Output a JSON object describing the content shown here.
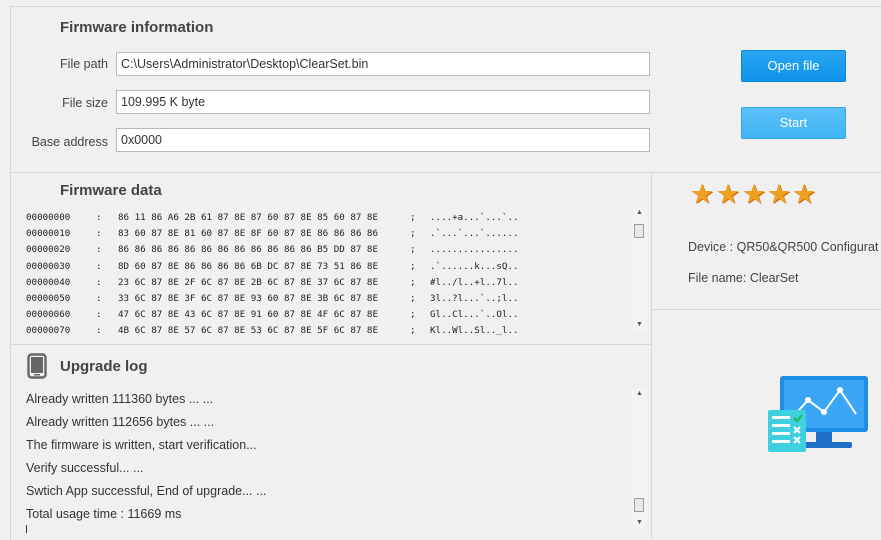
{
  "firmware_info": {
    "title": "Firmware information",
    "file_path_label": "File path",
    "file_path_value": "C:\\Users\\Administrator\\Desktop\\ClearSet.bin",
    "file_size_label": "File size",
    "file_size_value": "109.995 K byte",
    "base_address_label": "Base address",
    "base_address_value": "0x0000"
  },
  "buttons": {
    "open_file": "Open file",
    "start": "Start"
  },
  "firmware_data": {
    "title": "Firmware data",
    "rows": [
      {
        "offset": "00000000",
        "colon": ":",
        "bytes": "86 11 86 A6 2B 61 87 8E 87 60 87 8E 85 60 87 8E",
        "sep": ";",
        "ascii": "....+a...`...`.."
      },
      {
        "offset": "00000010",
        "colon": ":",
        "bytes": "83 60 87 8E 81 60 87 8E 8F 60 87 8E 86 86 86 86",
        "sep": ";",
        "ascii": ".`...`...`......"
      },
      {
        "offset": "00000020",
        "colon": ":",
        "bytes": "86 86 86 86 86 86 86 86 86 86 86 86 B5 DD 87 8E",
        "sep": ";",
        "ascii": "................"
      },
      {
        "offset": "00000030",
        "colon": ":",
        "bytes": "8D 60 87 8E 86 86 86 86 6B DC 87 8E 73 51 86 8E",
        "sep": ";",
        "ascii": ".`......k...sQ.."
      },
      {
        "offset": "00000040",
        "colon": ":",
        "bytes": "23 6C 87 8E 2F 6C 87 8E 2B 6C 87 8E 37 6C 87 8E",
        "sep": ";",
        "ascii": "#l../l..+l..7l.."
      },
      {
        "offset": "00000050",
        "colon": ":",
        "bytes": "33 6C 87 8E 3F 6C 87 8E 93 60 87 8E 3B 6C 87 8E",
        "sep": ";",
        "ascii": "3l..?l...`..;l.."
      },
      {
        "offset": "00000060",
        "colon": ":",
        "bytes": "47 6C 87 8E 43 6C 87 8E 91 60 87 8E 4F 6C 87 8E",
        "sep": ";",
        "ascii": "Gl..Cl...`..Ol.."
      },
      {
        "offset": "00000070",
        "colon": ":",
        "bytes": "4B 6C 87 8E 57 6C 87 8E 53 6C 87 8E 5F 6C 87 8E",
        "sep": ";",
        "ascii": "Kl..Wl..Sl.._l.."
      }
    ]
  },
  "upgrade_log": {
    "title": "Upgrade log",
    "lines": [
      "Already written 111360 bytes ... ...",
      "Already written 112656 bytes ... ...",
      "The firmware is written, start verification...",
      "Verify successful... ...",
      "Swtich App successful, End of upgrade... ...",
      "Total usage time :  11669 ms"
    ]
  },
  "device_info": {
    "rating": 5,
    "device": "Device : QR50&QR500 Configurat",
    "file_name": "File name: ClearSet"
  },
  "icons": {
    "phone": "phone-icon",
    "star": "star-icon",
    "monitor": "monitor-chart-icon",
    "accent": "#1a9cf0",
    "star_color": "#f0a020"
  }
}
